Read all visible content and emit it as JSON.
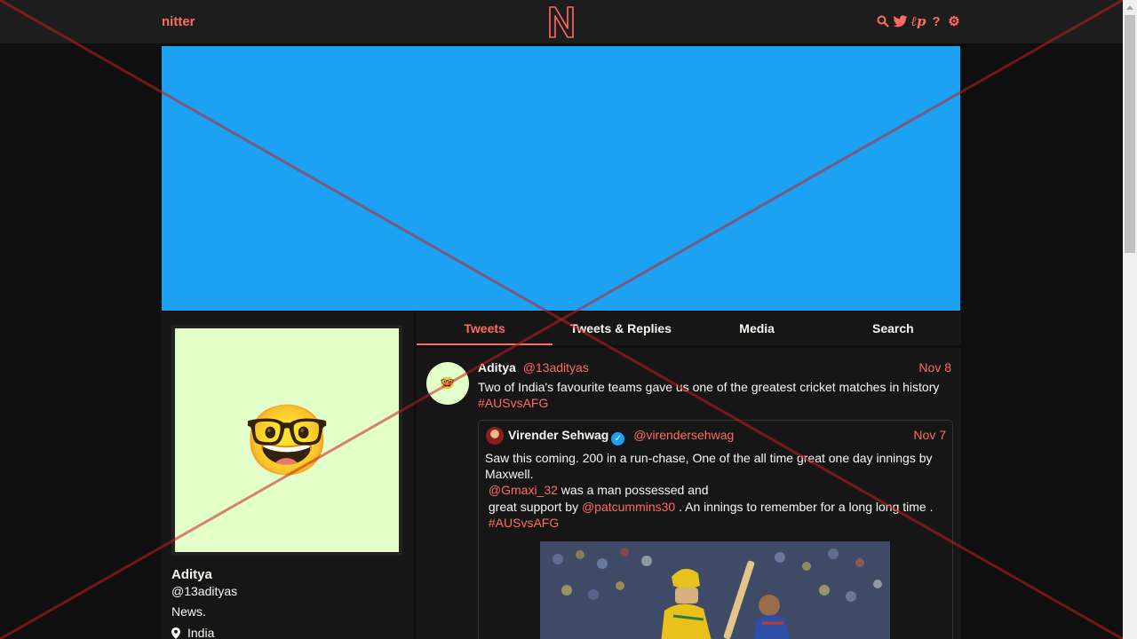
{
  "nav": {
    "logo_text": "nitter",
    "icons": [
      "search-icon",
      "twitter-icon",
      "rss-icon",
      "help-icon",
      "gear-icon"
    ]
  },
  "colors": {
    "accent": "#ff6c60",
    "banner": "#1da1f2",
    "background": "#0f0f0f",
    "panel": "#161616",
    "avatar_bg": "#e2ffc9"
  },
  "profile": {
    "avatar_emoji": "🤓",
    "fullname": "Aditya",
    "username": "@13adityas",
    "bio": "News.",
    "location": "India"
  },
  "tabs": [
    {
      "label": "Tweets",
      "active": true
    },
    {
      "label": "Tweets & Replies",
      "active": false
    },
    {
      "label": "Media",
      "active": false
    },
    {
      "label": "Search",
      "active": false
    }
  ],
  "tweet": {
    "avatar_emoji": "🤓",
    "fullname": "Aditya",
    "username": "@13adityas",
    "date": "Nov 8",
    "text": "Two of India's favourite teams gave us one of the greatest cricket matches in history",
    "hashtag": "#AUSvsAFG",
    "quote": {
      "fullname": "Virender Sehwag",
      "username": "@virendersehwag",
      "date": "Nov 7",
      "line1": "Saw this coming. 200 in a run-chase, One of the all time great one day innings  by Maxwell.",
      "mention1": "@Gmaxi_32",
      "line2": " was a man possessed and",
      "line3_pre": "great support by ",
      "mention2": "@patcummins30",
      "line3_post": " . An innings to remember for a long long time .",
      "hashtag": "#AUSvsAFG"
    }
  }
}
